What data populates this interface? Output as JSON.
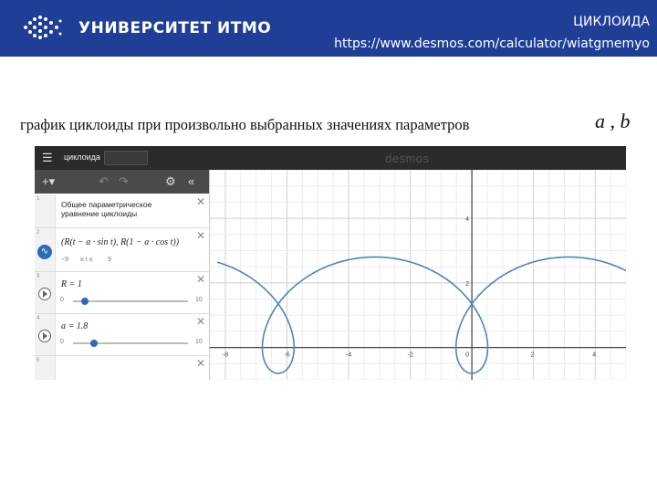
{
  "slide": {
    "brand": "УНИВЕРСИТЕТ ИТМО",
    "title": "ЦИКЛОИДА",
    "url": "https://www.desmos.com/calculator/wiatgmemyo",
    "caption": "график циклоиды при произвольно выбранных значениях параметров",
    "params": "a , b"
  },
  "colors": {
    "topbar": "#1f3f97",
    "curve": "#4a86c0",
    "accent": "#2f6ab4"
  },
  "desmos": {
    "graph_title": "циклоида",
    "logo": "desmos",
    "toolbar": {
      "add": "+▾",
      "undo": "↶",
      "redo": "↷",
      "settings": "⚙",
      "collapse": "«"
    },
    "rows": [
      {
        "num": "1",
        "note": "Общее параметрическое уравнение циклоиды"
      },
      {
        "num": "2",
        "formula": "(R(t − a · sin t), R(1 − a · cos t))",
        "domain_min": "−9",
        "domain_op": "≤ t ≤",
        "domain_max": "9"
      },
      {
        "num": "3",
        "formula": "R = 1",
        "slider_min": "0",
        "slider_max": "10",
        "value": 1
      },
      {
        "num": "4",
        "formula": "a = 1.8",
        "slider_min": "0",
        "slider_max": "10",
        "value": 1.8
      },
      {
        "num": "5"
      }
    ],
    "x_ticks": [
      "-8",
      "-6",
      "-4",
      "-2",
      "0",
      "2",
      "4"
    ],
    "y_ticks": [
      "4",
      "2"
    ],
    "x_range": [
      -8.5,
      5
    ],
    "y_range": [
      -1,
      5.5
    ],
    "curve": {
      "R": 1,
      "a": 1.8,
      "t_min": -9,
      "t_max": 9
    }
  }
}
